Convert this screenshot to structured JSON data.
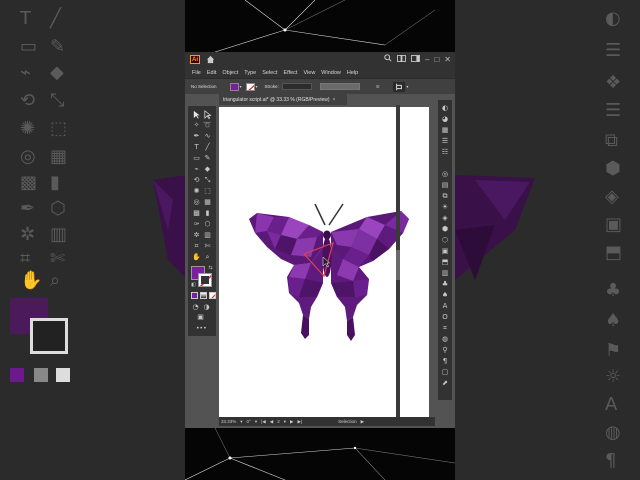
{
  "window": {
    "app_logo": "Ai",
    "title_controls": [
      "search-icon",
      "arrange-icon",
      "workspace-icon",
      "minimize-icon",
      "maximize-icon",
      "close-icon"
    ],
    "minimize": "–",
    "maximize": "□",
    "close": "✕"
  },
  "menu": [
    "File",
    "Edit",
    "Object",
    "Type",
    "Select",
    "Effect",
    "View",
    "Window",
    "Help"
  ],
  "control_bar": {
    "selection_label": "No Selection",
    "fill_color": "#7a1fa0",
    "stroke_label": "Stroke:"
  },
  "document": {
    "tab_title": "triangulator script.ai* @ 33.33 % (RGB/Preview)",
    "tab_close": "×"
  },
  "status": {
    "zoom": "33.33%",
    "rotation": "0°",
    "artboard_number": "2",
    "tool_name": "Selection"
  },
  "colors": {
    "accent_purple": "#7a1fa0",
    "butterfly_dark": "#4a1060",
    "butterfly_mid": "#7b2a9c",
    "highlight_stroke": "#e0404a",
    "ui_dark": "#323232",
    "ui_canvas": "#535353"
  },
  "icons": {
    "home": "home-icon",
    "search": "search-icon",
    "selection_tool": "selection-tool-icon",
    "direct_selection_tool": "direct-selection-icon",
    "type_tool": "type-tool-icon",
    "hand_tool": "hand-tool-icon",
    "zoom_tool": "zoom-tool-icon"
  }
}
